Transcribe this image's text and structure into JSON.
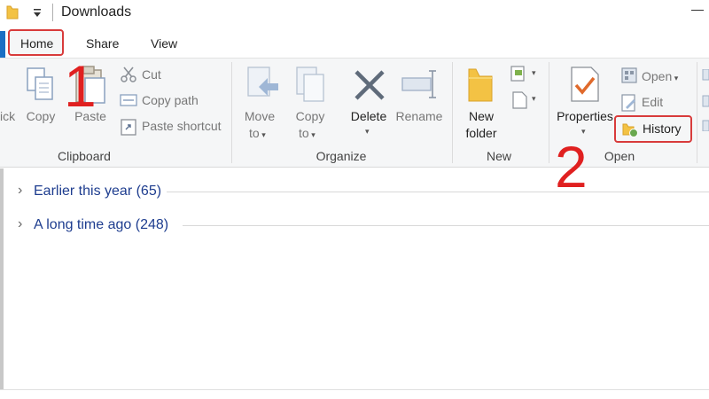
{
  "window": {
    "title": "Downloads"
  },
  "tabs": {
    "home": "Home",
    "share": "Share",
    "view": "View"
  },
  "ribbon": {
    "clipboard": {
      "label": "Clipboard",
      "pin_partial": "ick",
      "copy": "Copy",
      "paste": "Paste",
      "cut": "Cut",
      "copy_path": "Copy path",
      "paste_shortcut": "Paste shortcut"
    },
    "organize": {
      "label": "Organize",
      "move_to_line1": "Move",
      "move_to_line2": "to",
      "copy_to_line1": "Copy",
      "copy_to_line2": "to",
      "delete": "Delete",
      "rename": "Rename"
    },
    "new": {
      "label": "New",
      "new_folder_line1": "New",
      "new_folder_line2": "folder"
    },
    "open": {
      "label": "Open",
      "properties": "Properties",
      "open": "Open",
      "edit": "Edit",
      "history": "History"
    }
  },
  "annotations": {
    "step1": "1",
    "step2": "2"
  },
  "groups": [
    {
      "label": "Earlier this year (65)"
    },
    {
      "label": "A long time ago (248)"
    }
  ],
  "colors": {
    "accent": "#1a6fc4",
    "highlight": "#d83b3b",
    "group_text": "#1e3d8f"
  }
}
